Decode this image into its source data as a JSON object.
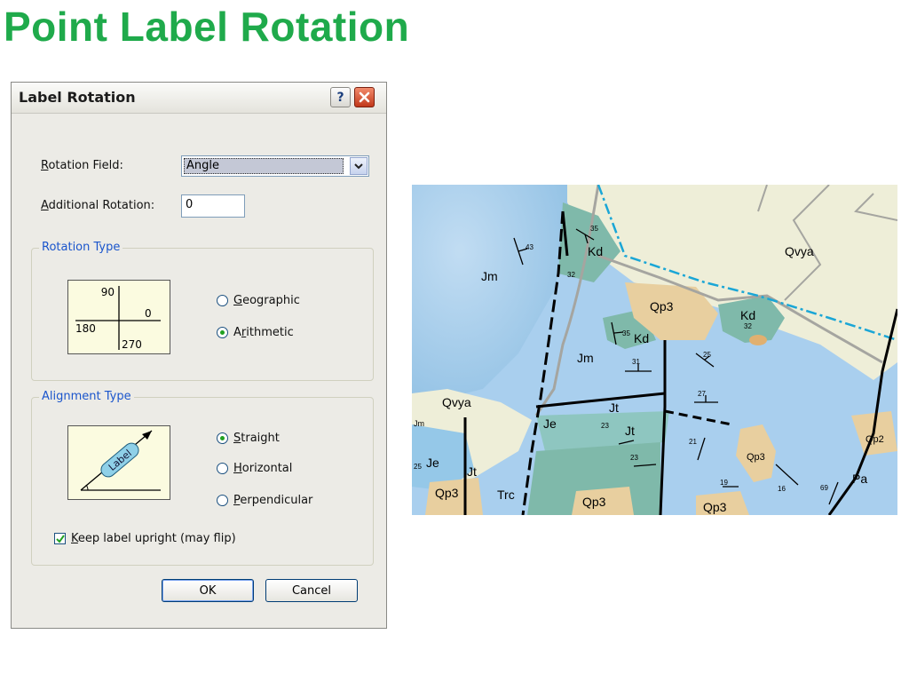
{
  "slide": {
    "title": "Point Label Rotation"
  },
  "dialog": {
    "title": "Label Rotation",
    "help_glyph": "?",
    "rotation_field": {
      "label_prefix": "R",
      "label_rest": "otation Field:",
      "value": "Angle"
    },
    "additional_rotation": {
      "label_prefix": "A",
      "label_rest": "dditional Rotation:",
      "value": "0"
    },
    "rotation_type": {
      "legend": "Rotation Type",
      "diagram": {
        "top": "90",
        "right": "0",
        "left": "180",
        "bottom": "270"
      },
      "options": [
        {
          "u": "G",
          "rest": "eographic",
          "selected": false
        },
        {
          "pre": "A",
          "u": "r",
          "rest": "ithmetic",
          "selected": true
        }
      ]
    },
    "alignment_type": {
      "legend": "Alignment Type",
      "diagram_label": "Label",
      "options": [
        {
          "u": "S",
          "rest": "traight",
          "selected": true
        },
        {
          "u": "H",
          "rest": "orizontal",
          "selected": false
        },
        {
          "u": "P",
          "rest": "erpendicular",
          "selected": false
        }
      ]
    },
    "keep_upright": {
      "u": "K",
      "rest": "eep label upright (may flip)",
      "checked": true
    },
    "ok_label": "OK",
    "cancel_label": "Cancel"
  },
  "map": {
    "units": [
      "Jm",
      "Kd",
      "Kd",
      "Kd",
      "Qp3",
      "Qvya",
      "Qvya",
      "Je",
      "Je",
      "Jm",
      "Jt",
      "Jt",
      "Jt",
      "Jm",
      "Trc",
      "Qp3",
      "Qp3",
      "Qp3",
      "Qp3",
      "Qp2",
      "Pa"
    ],
    "dips": [
      "43",
      "35",
      "32",
      "35",
      "32",
      "31",
      "25",
      "27",
      "23",
      "23",
      "21",
      "19",
      "16",
      "69",
      "25"
    ]
  },
  "colors": {
    "title_green": "#1faa4b",
    "legend_blue": "#1a55cc",
    "fault_line": "#000000",
    "boundary_cyan": "#1aa6d6"
  }
}
